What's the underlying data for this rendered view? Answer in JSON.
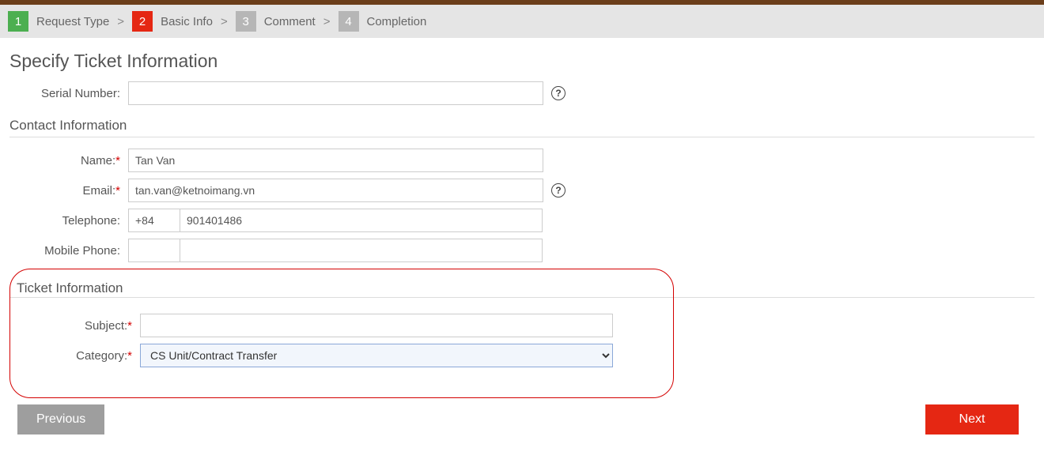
{
  "breadcrumb": {
    "steps": [
      {
        "num": "1",
        "label": "Request Type",
        "state": "green"
      },
      {
        "num": "2",
        "label": "Basic Info",
        "state": "red"
      },
      {
        "num": "3",
        "label": "Comment",
        "state": ""
      },
      {
        "num": "4",
        "label": "Completion",
        "state": ""
      }
    ]
  },
  "page_title": "Specify Ticket Information",
  "serial": {
    "label": "Serial Number:",
    "value": ""
  },
  "contact_section": "Contact Information",
  "contact": {
    "name_label": "Name:",
    "name_value": "Tan Van",
    "email_label": "Email:",
    "email_value": "tan.van@ketnoimang.vn",
    "tel_label": "Telephone:",
    "tel_code": "+84",
    "tel_value": "901401486",
    "mobile_label": "Mobile Phone:",
    "mobile_code": "",
    "mobile_value": ""
  },
  "ticket_section": "Ticket Information",
  "ticket": {
    "subject_label": "Subject:",
    "subject_value": "",
    "category_label": "Category:",
    "category_value": "CS Unit/Contract Transfer"
  },
  "footer": {
    "prev": "Previous",
    "next": "Next"
  }
}
